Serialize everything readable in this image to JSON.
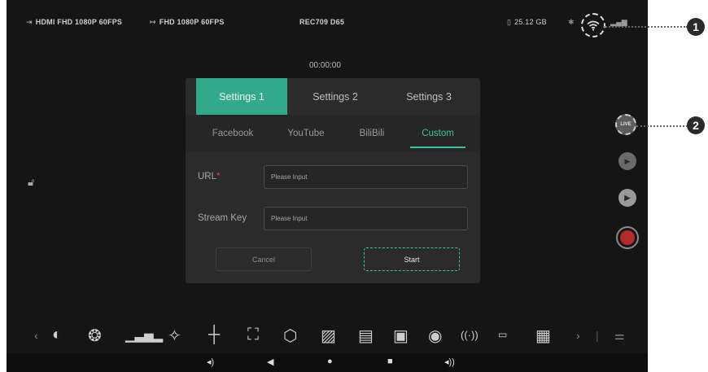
{
  "topbar": {
    "input_label": "HDMI FHD 1080P 60FPS",
    "output_label": "FHD 1080P 60FPS",
    "color_label": "REC709 D65",
    "storage_label": "25.12 GB"
  },
  "timecode": "00:00:00",
  "dialog": {
    "tabs": [
      "Settings 1",
      "Settings 2",
      "Settings 3"
    ],
    "active_tab": "Settings 1",
    "platforms": [
      "Facebook",
      "YouTube",
      "BiliBili",
      "Custom"
    ],
    "active_platform": "Custom",
    "url_label": "URL",
    "url_required_mark": "*",
    "url_placeholder": "Please Input",
    "stream_key_label": "Stream Key",
    "stream_key_placeholder": "Please Input",
    "cancel_label": "Cancel",
    "start_label": "Start"
  },
  "side_controls": {
    "live_label": "LIVE"
  },
  "callouts": [
    "1",
    "2"
  ],
  "icons": {
    "input": "hdmi-in-icon",
    "output": "output-icon",
    "storage": "sd-card-icon",
    "wifi": "wifi-icon",
    "lock": "lock-icon",
    "toolbar": [
      "chevron-left-icon",
      "false-color-icon",
      "rgb-parade-icon",
      "histogram-icon",
      "vectorscope-icon",
      "crosshair-icon",
      "focus-frame-icon",
      "lut-cube-icon",
      "zebra-icon",
      "waveform-icon",
      "frame-guide-icon",
      "audio-icon",
      "timecode-icon",
      "grid-icon",
      "chevron-right-icon",
      "settings-sliders-icon"
    ]
  },
  "colors": {
    "accent": "#33a98c",
    "record": "#b32b2b",
    "required": "#e04848"
  }
}
